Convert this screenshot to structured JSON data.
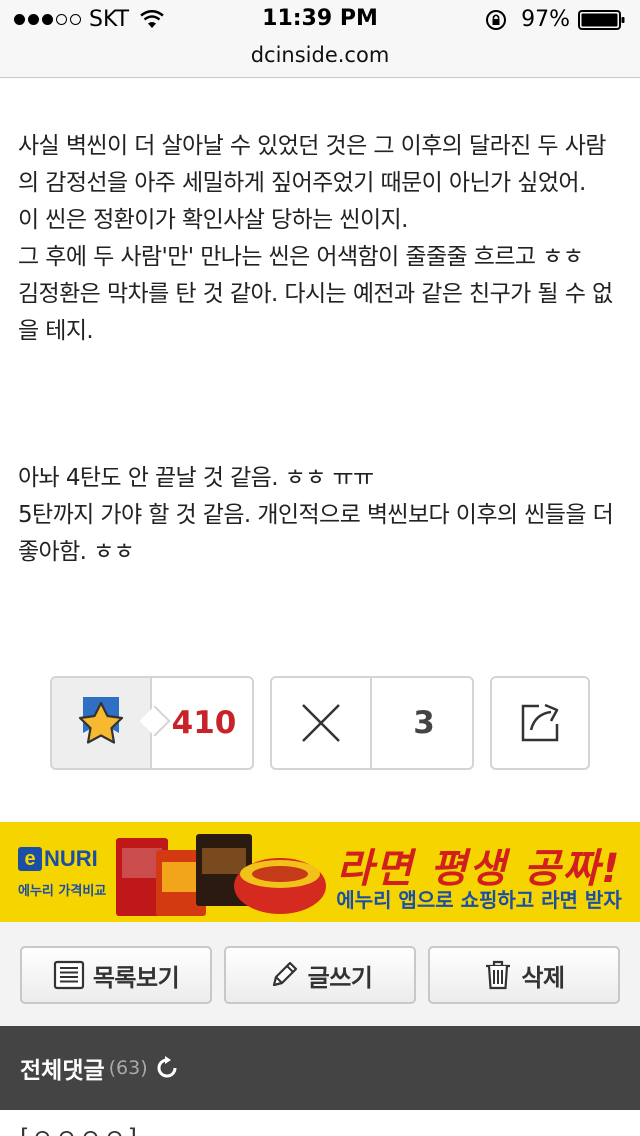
{
  "status_bar": {
    "carrier": "SKT",
    "time": "11:39 PM",
    "battery": "97%"
  },
  "url_bar": {
    "domain": "dcinside.com"
  },
  "article": {
    "paragraph1": "사실 벽씬이 더 살아날 수 있었던 것은 그 이후의 달라진 두 사람의 감정선을 아주 세밀하게 짚어주었기 때문이 아닌가 싶었어.",
    "paragraph2": "이 씬은 정환이가 확인사살 당하는 씬이지.",
    "paragraph3": "그 후에 두 사람'만' 만나는 씬은 어색함이 줄줄줄 흐르고 ㅎㅎ",
    "paragraph4": "김정환은 막차를 탄 것 같아. 다시는 예전과 같은 친구가 될 수 없을 테지.",
    "paragraph5": "아놔 4탄도 안 끝날 것 같음. ㅎㅎ ㅠㅠ",
    "paragraph6": "5탄까지 가야 할 것 같음. 개인적으로 벽씬보다 이후의 씬들을 더 좋아함. ㅎㅎ"
  },
  "actions": {
    "recommend_count": "410",
    "nonrecommend_count": "3"
  },
  "banner": {
    "brand": "NURI",
    "brand_sub": "에누리 가격비교",
    "headline": "라면 평생 공짜!",
    "subline": "에누리 앱으로 쇼핑하고 라면 받자"
  },
  "bottom_buttons": {
    "list_label": "목록보기",
    "write_label": "글쓰기",
    "delete_label": "삭제"
  },
  "comments": {
    "title": "전체댓글",
    "count": "(63)",
    "peek": "[ㅇㅇㅇㅇ]"
  },
  "colors": {
    "recommend": "#c8232b",
    "banner_bg": "#f6d400",
    "comments_header_bg": "#444444"
  }
}
